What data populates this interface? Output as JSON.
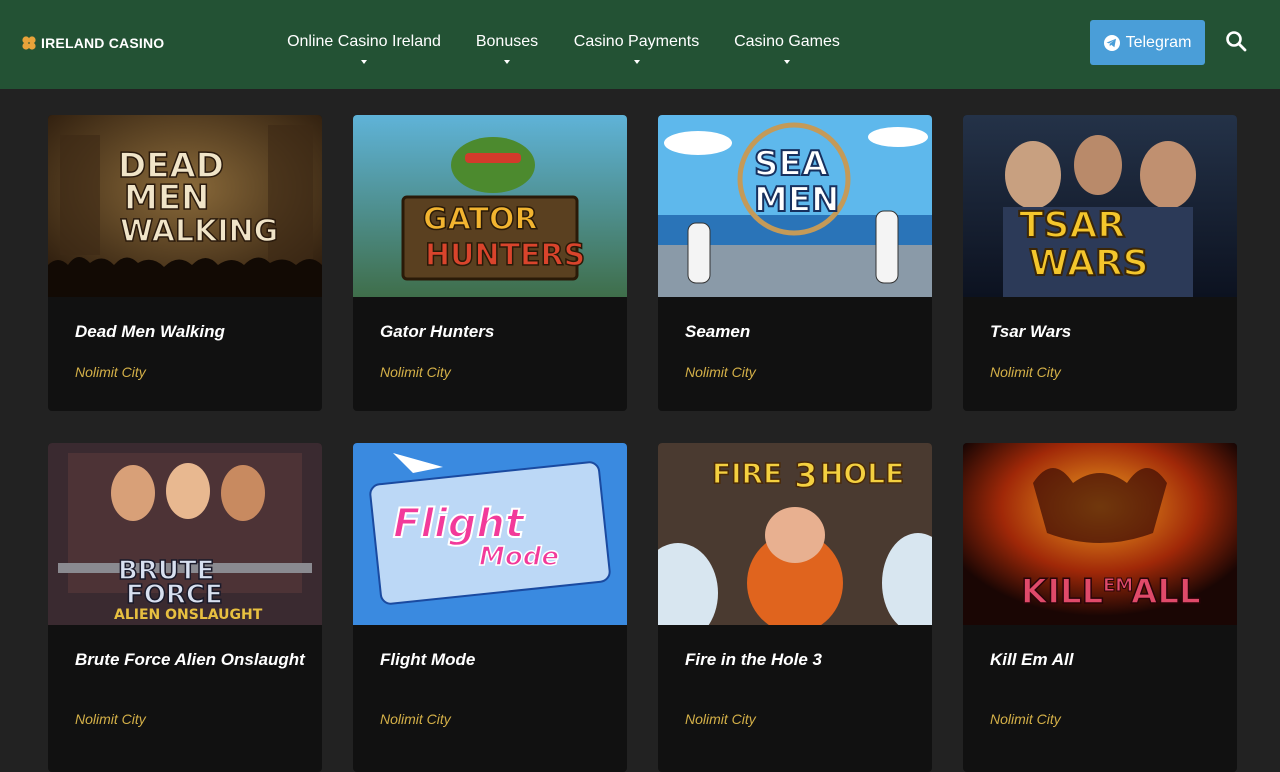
{
  "header": {
    "logo_text": "IRELAND CASINO",
    "nav": [
      {
        "label": "Online Casino Ireland"
      },
      {
        "label": "Bonuses"
      },
      {
        "label": "Casino Payments"
      },
      {
        "label": "Casino Games"
      }
    ],
    "telegram_label": "Telegram",
    "search_icon": "search-icon"
  },
  "colors": {
    "header_bg": "#235234",
    "page_bg": "#222222",
    "card_bg": "#111111",
    "telegram_btn": "#4a9ed8",
    "provider_text": "#d4b048",
    "logo_leaf": "#e8a33a"
  },
  "games": [
    {
      "title": "Dead Men Walking",
      "provider": "Nolimit City",
      "art_text": [
        "DEAD",
        "MEN",
        "WALKING"
      ]
    },
    {
      "title": "Gator Hunters",
      "provider": "Nolimit City",
      "art_text": [
        "GATOR",
        "HUNTERS"
      ]
    },
    {
      "title": "Seamen",
      "provider": "Nolimit City",
      "art_text": [
        "SEA",
        "MEN"
      ]
    },
    {
      "title": "Tsar Wars",
      "provider": "Nolimit City",
      "art_text": [
        "TSAR",
        "WARS"
      ]
    },
    {
      "title": "Brute Force Alien Onslaught",
      "provider": "Nolimit City",
      "art_text": [
        "BRUTE",
        "FORCE",
        "ALIEN ONSLAUGHT"
      ]
    },
    {
      "title": "Flight Mode",
      "provider": "Nolimit City",
      "art_text": [
        "Flight",
        "Mode"
      ]
    },
    {
      "title": "Fire in the Hole 3",
      "provider": "Nolimit City",
      "art_text": [
        "FIRE",
        "3",
        "HOLE"
      ]
    },
    {
      "title": "Kill Em All",
      "provider": "Nolimit City",
      "art_text": [
        "KILL",
        "EM",
        "ALL"
      ]
    }
  ]
}
